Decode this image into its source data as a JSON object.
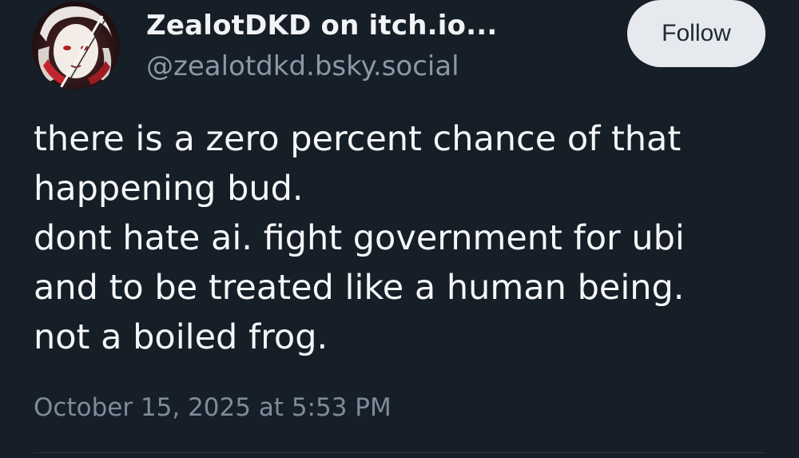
{
  "author": {
    "display_name": "ZealotDKD on itch.io...",
    "handle": "@zealotdkd.bsky.social",
    "avatar_icon": "avatar-illustration"
  },
  "actions": {
    "follow_label": "Follow"
  },
  "post": {
    "lines": [
      "there is a zero percent chance of that",
      "happening bud.",
      "dont hate ai. fight government for ubi",
      "and to be treated like a human being.",
      "not a boiled frog."
    ],
    "timestamp": "October 15, 2025 at 5:53 PM"
  },
  "colors": {
    "background": "#161e27",
    "text_primary": "#f1f3f5",
    "text_secondary": "#8b98a8",
    "follow_button_bg": "#e6e9ee"
  }
}
